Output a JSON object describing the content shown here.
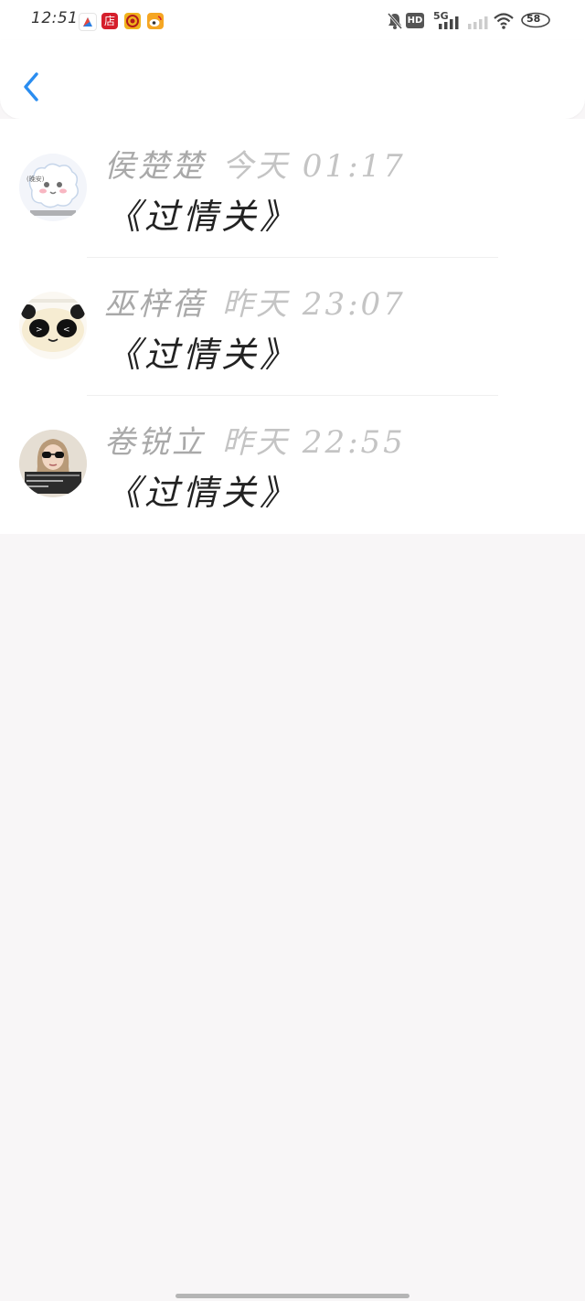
{
  "status_bar": {
    "time": "12:51",
    "app_icons": [
      {
        "name": "compass-app-icon",
        "glyph": "➶",
        "color": "#ffffff"
      },
      {
        "name": "store-app-icon",
        "glyph": "店",
        "color": "#d51f2c"
      },
      {
        "name": "target-app-icon",
        "glyph": "◎",
        "color": "#f0b21c"
      },
      {
        "name": "weibo-app-icon",
        "glyph": "微",
        "color": "#f5a623"
      }
    ],
    "hd_label": "HD",
    "network_label": "5G",
    "battery_level": "58"
  },
  "navbar": {
    "back_icon": "chevron-left-icon",
    "accent_color": "#2a8df0"
  },
  "messages": [
    {
      "name": "侯楚楚",
      "time": "今天 01:17",
      "text": "《过情关》",
      "avatar": "sheep-avatar"
    },
    {
      "name": "巫梓蓓",
      "time": "昨天 23:07",
      "text": "《过情关》",
      "avatar": "panda-avatar"
    },
    {
      "name": "卷锐立",
      "time": "昨天 22:55",
      "text": "《过情关》",
      "avatar": "girl-sunglasses-avatar"
    }
  ]
}
